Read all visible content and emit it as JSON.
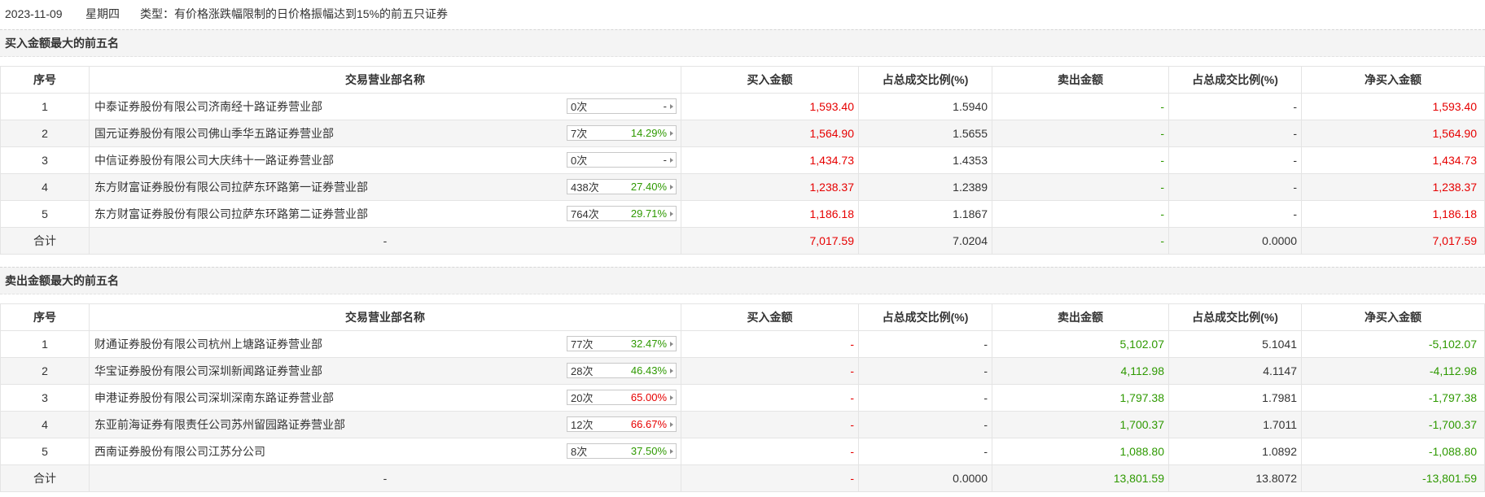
{
  "colors": {
    "red": "#e60000",
    "green": "#2e9900",
    "neutral": "#333333"
  },
  "icons": {
    "badge_arrow": "caret-right-icon"
  },
  "info": {
    "date": "2023-11-09",
    "weekday": "星期四",
    "type": "类型：有价格涨跌幅限制的日价格振幅达到15%的前五只证券"
  },
  "columns": [
    "序号",
    "交易营业部名称",
    "买入金额",
    "占总成交比例(%)",
    "卖出金额",
    "占总成交比例(%)",
    "净买入金额"
  ],
  "buy": {
    "title": "买入金额最大的前五名",
    "rows": [
      {
        "no": "1",
        "name": "中泰证券股份有限公司济南经十路证券营业部",
        "badge": {
          "count": "0次",
          "pct": "-",
          "pct_tone": "neutral"
        },
        "cells": [
          {
            "v": "1,593.40",
            "tone": "red"
          },
          {
            "v": "1.5940",
            "tone": "neutral"
          },
          {
            "v": "-",
            "tone": "green"
          },
          {
            "v": "-",
            "tone": "neutral"
          },
          {
            "v": "1,593.40",
            "tone": "red"
          }
        ]
      },
      {
        "no": "2",
        "name": "国元证券股份有限公司佛山季华五路证券营业部",
        "badge": {
          "count": "7次",
          "pct": "14.29%",
          "pct_tone": "green"
        },
        "cells": [
          {
            "v": "1,564.90",
            "tone": "red"
          },
          {
            "v": "1.5655",
            "tone": "neutral"
          },
          {
            "v": "-",
            "tone": "green"
          },
          {
            "v": "-",
            "tone": "neutral"
          },
          {
            "v": "1,564.90",
            "tone": "red"
          }
        ]
      },
      {
        "no": "3",
        "name": "中信证券股份有限公司大庆纬十一路证券营业部",
        "badge": {
          "count": "0次",
          "pct": "-",
          "pct_tone": "neutral"
        },
        "cells": [
          {
            "v": "1,434.73",
            "tone": "red"
          },
          {
            "v": "1.4353",
            "tone": "neutral"
          },
          {
            "v": "-",
            "tone": "green"
          },
          {
            "v": "-",
            "tone": "neutral"
          },
          {
            "v": "1,434.73",
            "tone": "red"
          }
        ]
      },
      {
        "no": "4",
        "name": "东方财富证券股份有限公司拉萨东环路第一证券营业部",
        "badge": {
          "count": "438次",
          "pct": "27.40%",
          "pct_tone": "green"
        },
        "cells": [
          {
            "v": "1,238.37",
            "tone": "red"
          },
          {
            "v": "1.2389",
            "tone": "neutral"
          },
          {
            "v": "-",
            "tone": "green"
          },
          {
            "v": "-",
            "tone": "neutral"
          },
          {
            "v": "1,238.37",
            "tone": "red"
          }
        ]
      },
      {
        "no": "5",
        "name": "东方财富证券股份有限公司拉萨东环路第二证券营业部",
        "badge": {
          "count": "764次",
          "pct": "29.71%",
          "pct_tone": "green"
        },
        "cells": [
          {
            "v": "1,186.18",
            "tone": "red"
          },
          {
            "v": "1.1867",
            "tone": "neutral"
          },
          {
            "v": "-",
            "tone": "green"
          },
          {
            "v": "-",
            "tone": "neutral"
          },
          {
            "v": "1,186.18",
            "tone": "red"
          }
        ]
      }
    ],
    "total": {
      "label": "合计",
      "name": "-",
      "cells": [
        {
          "v": "7,017.59",
          "tone": "red"
        },
        {
          "v": "7.0204",
          "tone": "neutral"
        },
        {
          "v": "-",
          "tone": "green"
        },
        {
          "v": "0.0000",
          "tone": "neutral"
        },
        {
          "v": "7,017.59",
          "tone": "red"
        }
      ]
    }
  },
  "sell": {
    "title": "卖出金额最大的前五名",
    "rows": [
      {
        "no": "1",
        "name": "财通证券股份有限公司杭州上塘路证券营业部",
        "badge": {
          "count": "77次",
          "pct": "32.47%",
          "pct_tone": "green"
        },
        "cells": [
          {
            "v": "-",
            "tone": "red"
          },
          {
            "v": "-",
            "tone": "neutral"
          },
          {
            "v": "5,102.07",
            "tone": "green"
          },
          {
            "v": "5.1041",
            "tone": "neutral"
          },
          {
            "v": "-5,102.07",
            "tone": "green"
          }
        ]
      },
      {
        "no": "2",
        "name": "华宝证券股份有限公司深圳新闻路证券营业部",
        "badge": {
          "count": "28次",
          "pct": "46.43%",
          "pct_tone": "green"
        },
        "cells": [
          {
            "v": "-",
            "tone": "red"
          },
          {
            "v": "-",
            "tone": "neutral"
          },
          {
            "v": "4,112.98",
            "tone": "green"
          },
          {
            "v": "4.1147",
            "tone": "neutral"
          },
          {
            "v": "-4,112.98",
            "tone": "green"
          }
        ]
      },
      {
        "no": "3",
        "name": "申港证券股份有限公司深圳深南东路证券营业部",
        "badge": {
          "count": "20次",
          "pct": "65.00%",
          "pct_tone": "red"
        },
        "cells": [
          {
            "v": "-",
            "tone": "red"
          },
          {
            "v": "-",
            "tone": "neutral"
          },
          {
            "v": "1,797.38",
            "tone": "green"
          },
          {
            "v": "1.7981",
            "tone": "neutral"
          },
          {
            "v": "-1,797.38",
            "tone": "green"
          }
        ]
      },
      {
        "no": "4",
        "name": "东亚前海证券有限责任公司苏州留园路证券营业部",
        "badge": {
          "count": "12次",
          "pct": "66.67%",
          "pct_tone": "red"
        },
        "cells": [
          {
            "v": "-",
            "tone": "red"
          },
          {
            "v": "-",
            "tone": "neutral"
          },
          {
            "v": "1,700.37",
            "tone": "green"
          },
          {
            "v": "1.7011",
            "tone": "neutral"
          },
          {
            "v": "-1,700.37",
            "tone": "green"
          }
        ]
      },
      {
        "no": "5",
        "name": "西南证券股份有限公司江苏分公司",
        "badge": {
          "count": "8次",
          "pct": "37.50%",
          "pct_tone": "green"
        },
        "cells": [
          {
            "v": "-",
            "tone": "red"
          },
          {
            "v": "-",
            "tone": "neutral"
          },
          {
            "v": "1,088.80",
            "tone": "green"
          },
          {
            "v": "1.0892",
            "tone": "neutral"
          },
          {
            "v": "-1,088.80",
            "tone": "green"
          }
        ]
      }
    ],
    "total": {
      "label": "合计",
      "name": "-",
      "cells": [
        {
          "v": "-",
          "tone": "red"
        },
        {
          "v": "0.0000",
          "tone": "neutral"
        },
        {
          "v": "13,801.59",
          "tone": "green"
        },
        {
          "v": "13.8072",
          "tone": "neutral"
        },
        {
          "v": "-13,801.59",
          "tone": "green"
        }
      ]
    }
  }
}
